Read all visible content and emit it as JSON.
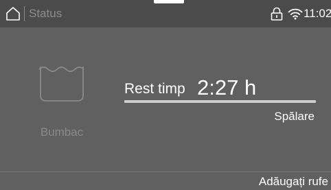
{
  "status_bar": {
    "title": "Status",
    "time": "11:02",
    "icons": [
      "home-icon",
      "lock-icon",
      "wifi-icon"
    ]
  },
  "program": {
    "icon": "tub-icon",
    "name": "Bumbac"
  },
  "remaining": {
    "label": "Rest timp",
    "value": "2:27 h",
    "progress_fraction": 1.0,
    "phase": "Spălare"
  },
  "actions": {
    "add_laundry": "Adăugați rufe"
  },
  "colors": {
    "background": "#606060",
    "status_bar": "#4b4b4b",
    "text": "#ffffff",
    "muted_text": "#8e8e8e",
    "progress": "#cfcfcf"
  }
}
